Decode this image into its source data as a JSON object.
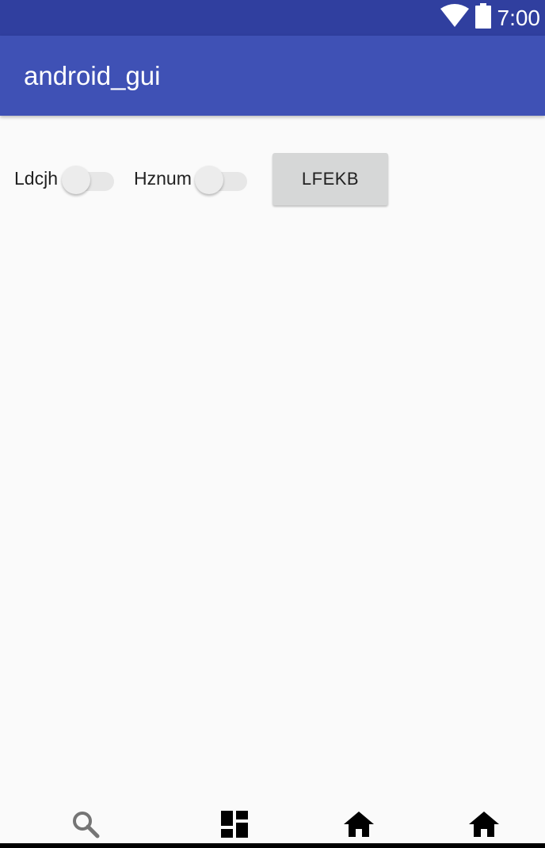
{
  "status_bar": {
    "time": "7:00",
    "icons": [
      "wifi-icon",
      "battery-icon"
    ]
  },
  "app_bar": {
    "title": "android_gui"
  },
  "main": {
    "switch_1": {
      "label": "Ldcjh",
      "checked": false
    },
    "switch_2": {
      "label": "Hznum",
      "checked": false
    },
    "button": {
      "label": "LFEKB"
    }
  },
  "bottom_nav": {
    "items": [
      "search-icon",
      "dashboard-icon",
      "home-icon",
      "home-icon"
    ]
  },
  "colors": {
    "status_bar": "#303f9f",
    "app_bar": "#3f51b5",
    "background": "#fafafa",
    "button": "#d6d7d7"
  }
}
